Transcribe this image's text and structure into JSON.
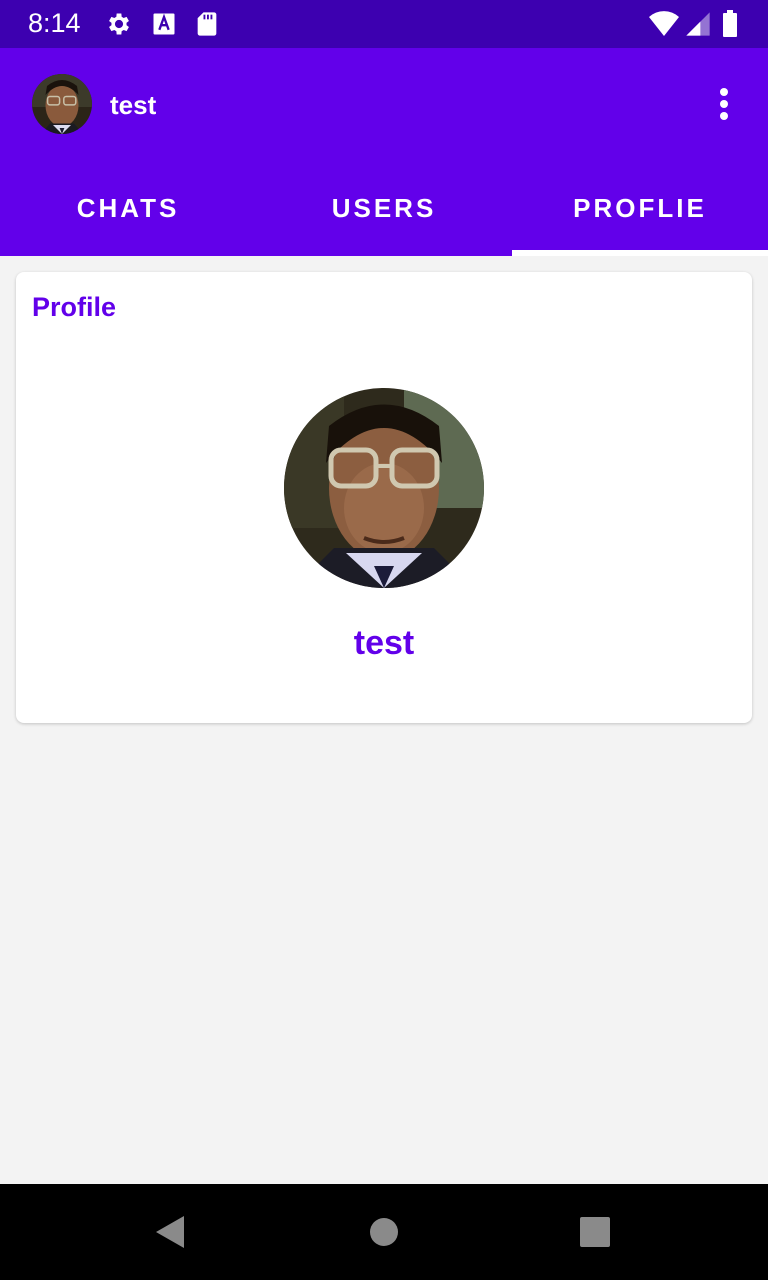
{
  "status_bar": {
    "time": "8:14",
    "left_icons": [
      "gear-icon",
      "text-a-icon",
      "sd-card-icon"
    ],
    "right_icons": [
      "wifi-icon",
      "cell-signal-icon",
      "battery-icon"
    ]
  },
  "app_bar": {
    "title": "test",
    "avatar": "user-avatar",
    "overflow_icon": "more-vert-icon"
  },
  "tabs": [
    {
      "label": "CHATS",
      "selected": false
    },
    {
      "label": "USERS",
      "selected": false
    },
    {
      "label": "PROFLIE",
      "selected": true
    }
  ],
  "profile_card": {
    "title": "Profile",
    "name": "test"
  },
  "colors": {
    "status_bar": "#3d00b0",
    "primary": "#6200ea",
    "background": "#f3f3f3",
    "card": "#ffffff",
    "nav_bar": "#000000",
    "nav_button": "#8a8a8a"
  },
  "nav_bar": {
    "buttons": [
      "back-icon",
      "home-icon",
      "recents-icon"
    ]
  }
}
